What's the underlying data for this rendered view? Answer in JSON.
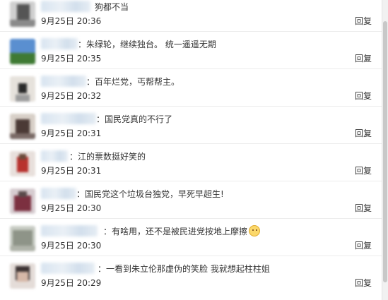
{
  "comments": [
    {
      "text": "狗都不当",
      "time": "9月25日 20:36",
      "reply": "回复"
    },
    {
      "text": "朱绿轮，继续独台。 统一遥遥无期",
      "time": "9月25日 20:35",
      "reply": "回复"
    },
    {
      "text": "百年烂党，丐帮帮主。",
      "time": "9月25日 20:32",
      "reply": "回复"
    },
    {
      "text": "国民党真的不行了",
      "time": "9月25日 20:31",
      "reply": "回复"
    },
    {
      "text": "江的票数挺好笑的",
      "time": "9月25日 20:31",
      "reply": "回复"
    },
    {
      "text": "国民党这个垃圾台独党，早死早超生!",
      "time": "9月25日 20:30",
      "reply": "回复"
    },
    {
      "text": "有啥用，还不是被民进党按地上摩擦",
      "time": "9月25日 20:30",
      "reply": "回复",
      "emoji": "laughing-face-emoji"
    },
    {
      "text": "一看到朱立伦那虚伪的笑脸 我就想起柱柱姐",
      "time": "9月25日 20:29",
      "reply": "回复"
    }
  ],
  "colon": "："
}
